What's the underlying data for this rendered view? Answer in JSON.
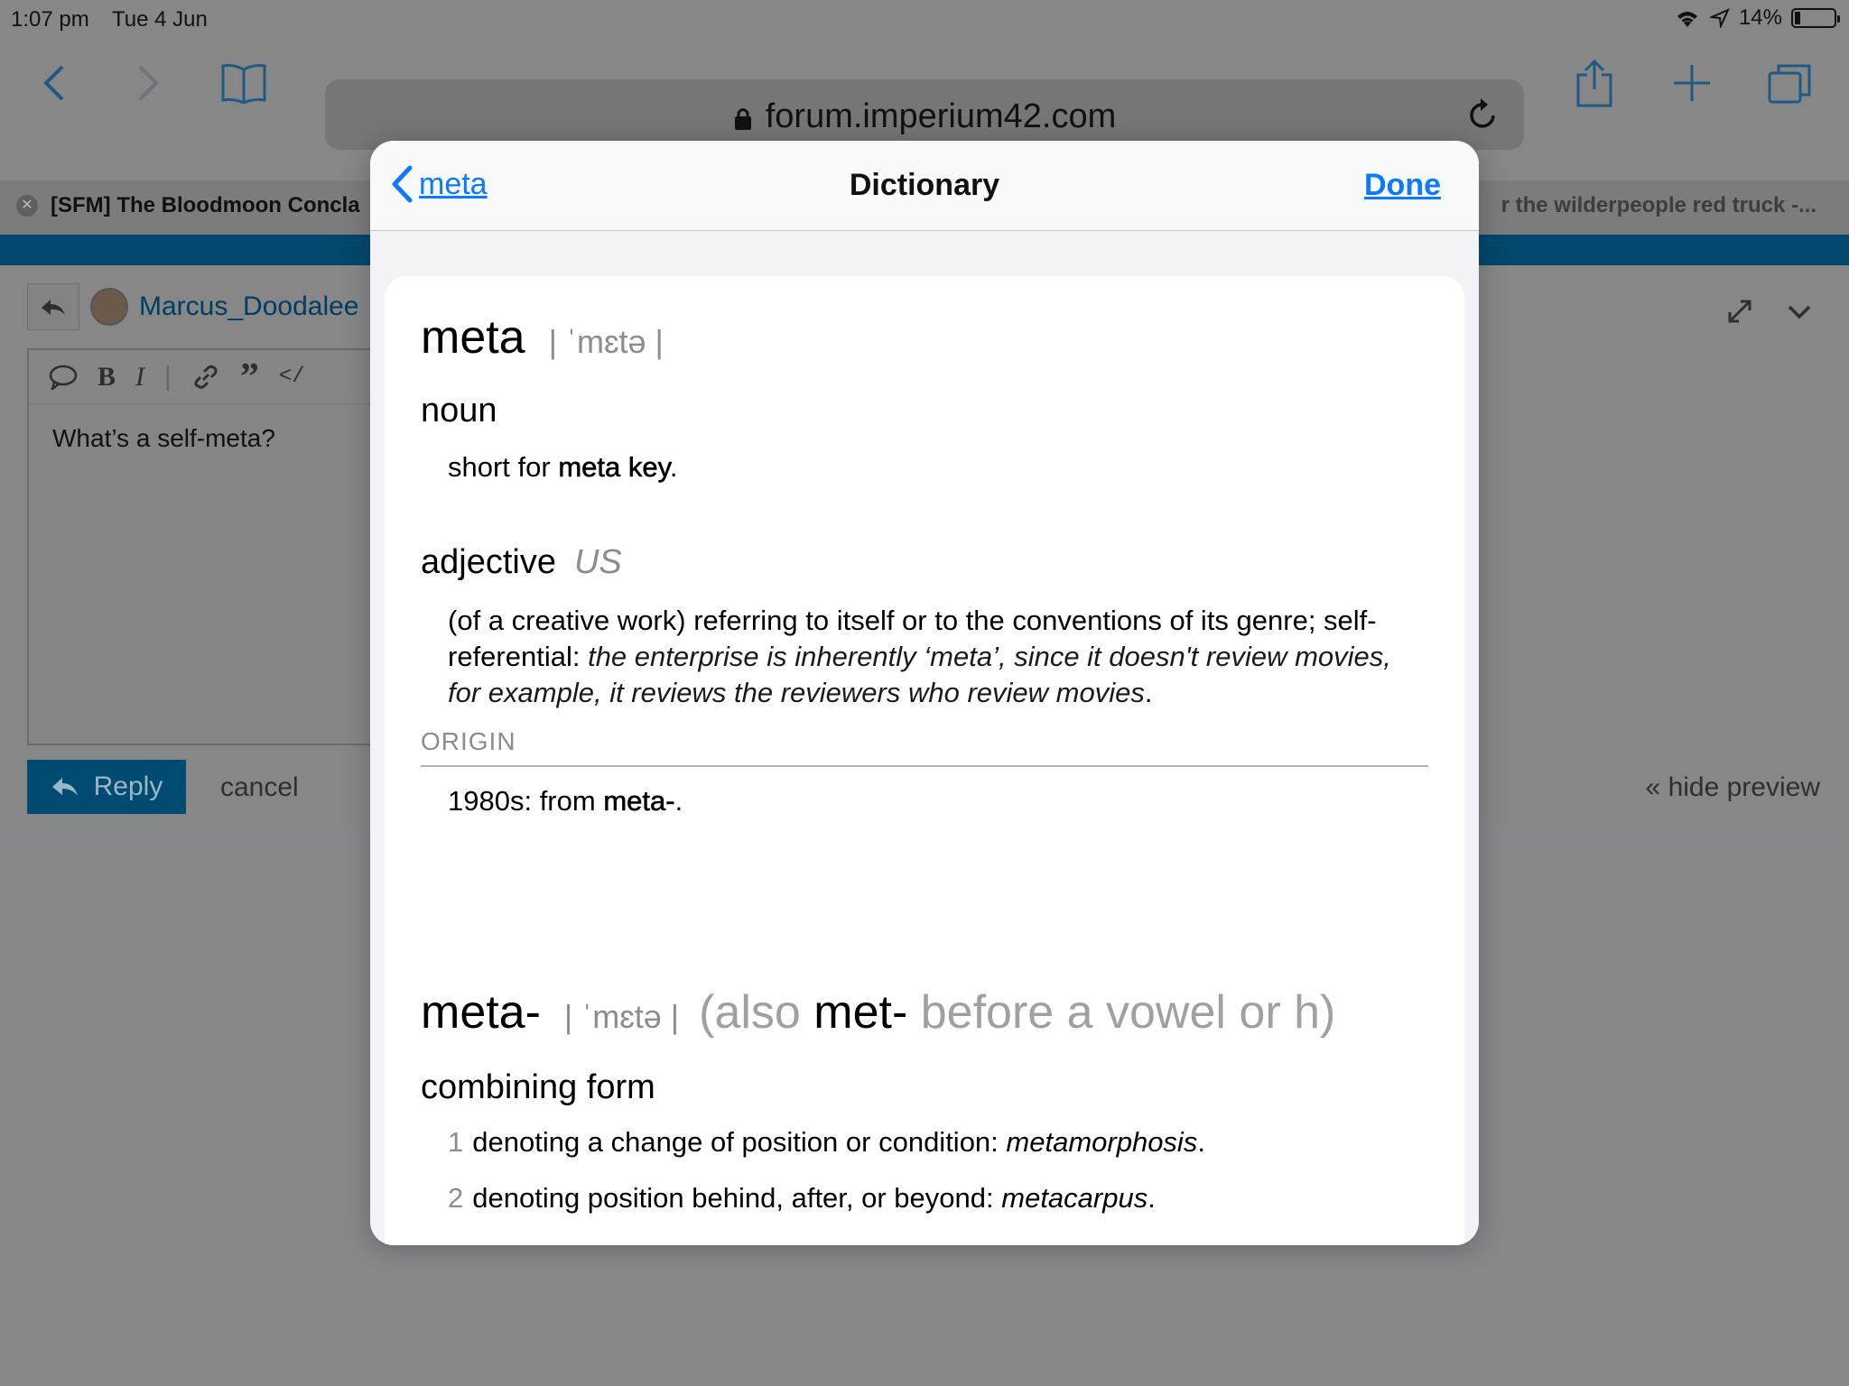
{
  "status_bar": {
    "time": "1:07 pm",
    "date": "Tue 4 Jun",
    "battery": "14%",
    "battery_level": 0.14
  },
  "browser": {
    "url": "forum.imperium42.com",
    "tab_left": "[SFM] The Bloodmoon Concla",
    "tab_right": "r the wilderpeople red truck -..."
  },
  "forum": {
    "username": "Marcus_Doodalee",
    "editor_text": "What’s a self-meta?",
    "reply_label": "Reply",
    "cancel_label": "cancel",
    "hide_preview_label": "« hide preview"
  },
  "dictionary": {
    "back_label": "meta",
    "title": "Dictionary",
    "done_label": "Done",
    "entry1": {
      "headword": "meta",
      "pronunciation": "| ˈmɛtə |",
      "noun_pos": "noun",
      "noun_sense_prefix": "short for ",
      "noun_sense_bold": "meta key",
      "noun_sense_suffix": ".",
      "adj_pos": "adjective",
      "adj_region": "US",
      "adj_sense_plain": "(of a creative work) referring to itself or to the conventions of its genre; self-referential: ",
      "adj_sense_example": "the enterprise is inherently ‘meta’, since it doesn't review movies, for example, it reviews the reviewers who review movies",
      "adj_sense_end": ".",
      "origin_label": "ORIGIN",
      "origin_prefix": "1980s: from ",
      "origin_bold": "meta-",
      "origin_suffix": "."
    },
    "entry2": {
      "headword": "meta-",
      "pronunciation": "| ˈmɛtə |",
      "also_open": "(also ",
      "also_bold": "met-",
      "also_rest": " before a vowel or h)",
      "pos": "combining form",
      "senses": [
        {
          "num": "1",
          "text": "denoting a change of position or condition: ",
          "example": "metamorphosis",
          "end": "."
        },
        {
          "num": "2",
          "text": "denoting position behind, after, or beyond: ",
          "example": "metacarpus",
          "end": "."
        }
      ]
    }
  }
}
